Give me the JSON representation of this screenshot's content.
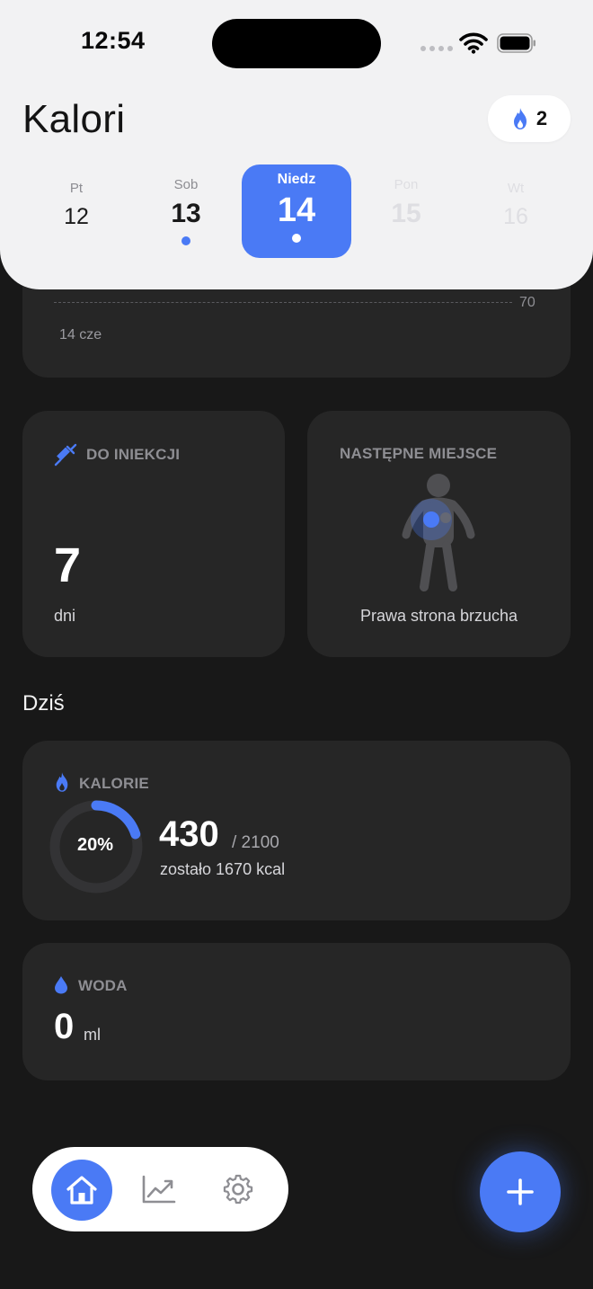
{
  "status_bar": {
    "time": "12:54"
  },
  "header": {
    "title": "Kalori",
    "streak_count": "2"
  },
  "days": [
    {
      "name": "Pt",
      "number": "12"
    },
    {
      "name": "Sob",
      "number": "13"
    },
    {
      "name": "Niedz",
      "number": "14"
    },
    {
      "name": "Pon",
      "number": "15"
    },
    {
      "name": "Wt",
      "number": "16"
    }
  ],
  "weight_chart": {
    "goal_line_value": "70",
    "date_label": "14 cze"
  },
  "injection": {
    "label": "DO INIEKCJI",
    "value": "7",
    "unit": "dni"
  },
  "next_site": {
    "label": "NASTĘPNE MIEJSCE",
    "site": "Prawa strona brzucha"
  },
  "today_heading": "Dziś",
  "calories": {
    "label": "KALORIE",
    "percent_text": "20%",
    "progress": 0.2,
    "consumed": "430",
    "goal": "/ 2100",
    "remaining": "zostało 1670 kcal"
  },
  "water": {
    "label": "WODA",
    "value": "0",
    "unit": "ml"
  },
  "colors": {
    "accent": "#4a7af5",
    "card": "#262626",
    "background": "#181818"
  },
  "nav": {
    "items": [
      "home-icon",
      "stats-icon",
      "settings-icon"
    ],
    "fab": "plus-icon"
  }
}
